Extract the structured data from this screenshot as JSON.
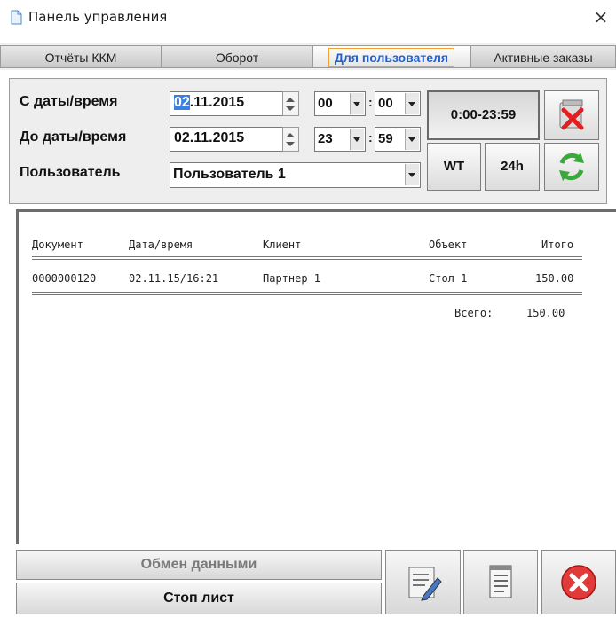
{
  "window": {
    "title": "Панель управления",
    "close_glyph": "×"
  },
  "tabs": [
    {
      "label": "Отчёты ККМ"
    },
    {
      "label": "Оборот"
    },
    {
      "label": "Для пользователя",
      "active": true
    },
    {
      "label": "Активные заказы"
    }
  ],
  "filters": {
    "from_label": "С даты/время",
    "from_date_selected": "02",
    "from_date_rest": ".11.2015",
    "from_hour": "00",
    "from_minute": "00",
    "to_label": "До даты/время",
    "to_date": "02.11.2015",
    "to_hour": "23",
    "to_minute": "59",
    "user_label": "Пользователь",
    "user_value": "Пользователь 1",
    "time_separator": ":"
  },
  "buttons": {
    "range": "0:00-23:59",
    "wt": "WT",
    "h24": "24h",
    "clear_icon": "clear-report-icon",
    "refresh_icon": "refresh-icon"
  },
  "report": {
    "headers": {
      "document": "Документ",
      "datetime": "Дата/время",
      "client": "Клиент",
      "object": "Объект",
      "total": "Итого"
    },
    "rows": [
      {
        "document": "0000000120",
        "datetime": "02.11.15/16:21",
        "client": "Партнер 1",
        "object": "Стол 1",
        "total": "150.00"
      }
    ],
    "grand_total_label": "Всего:",
    "grand_total_value": "150.00"
  },
  "footer": {
    "exchange_label": "Обмен данными",
    "stop_list_label": "Стоп лист",
    "edit_icon": "edit-notes-icon",
    "notepad_icon": "notepad-icon",
    "close_icon": "close-icon"
  },
  "colors": {
    "accent_tab_border": "#f3a130",
    "accent_tab_text": "#2060d0",
    "selection": "#3b7fe0"
  }
}
